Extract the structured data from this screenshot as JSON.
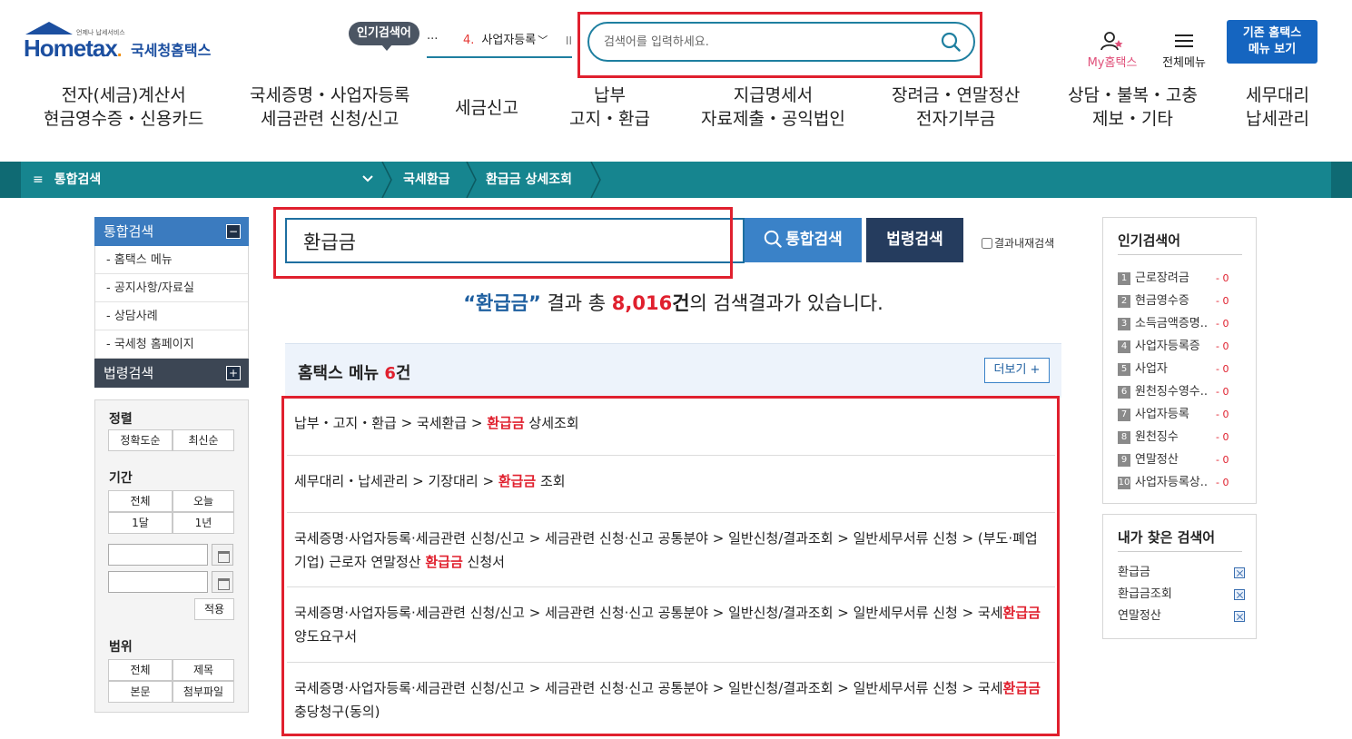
{
  "header": {
    "logo_tagline": "언제나 납세서비스",
    "logo_main": "Hometax",
    "logo_suffix": ".",
    "logo_korean": "국세청홈택스",
    "popular_badge": "인기검색어",
    "popular_dots": "···",
    "popular_ticker_rank": "4.",
    "popular_ticker_keyword": "사업자등록",
    "popular_ticker_pause": "II",
    "search_placeholder": "검색어를 입력하세요.",
    "my_hometax": "My홈택스",
    "all_menu": "전체메뉴",
    "old_menu_line1": "기존 홈택스",
    "old_menu_line2": "메뉴 보기"
  },
  "gnb": [
    {
      "line1": "전자(세금)계산서",
      "line2": "현금영수증・신용카드"
    },
    {
      "line1": "국세증명・사업자등록",
      "line2": "세금관련 신청/신고"
    },
    {
      "line1": "세금신고",
      "line2": ""
    },
    {
      "line1": "납부",
      "line2": "고지・환급"
    },
    {
      "line1": "지급명세서",
      "line2": "자료제출・공익법인"
    },
    {
      "line1": "장려금・연말정산",
      "line2": "전자기부금"
    },
    {
      "line1": "상담・불복・고충",
      "line2": "제보・기타"
    },
    {
      "line1": "세무대리",
      "line2": "납세관리"
    }
  ],
  "location": {
    "menu_icon": "≡",
    "menu_label": "통합검색",
    "crumb1": "국세환급",
    "crumb2": "환급금 상세조회"
  },
  "sidebar": {
    "total_search": "통합검색",
    "total_toggle": "−",
    "items": [
      "- 홈택스 메뉴",
      "- 공지사항/자료실",
      "- 상담사례",
      "- 국세청 홈페이지"
    ],
    "law_search": "법령검색",
    "law_toggle": "+",
    "sort_label": "정렬",
    "sort_options": [
      "정확도순",
      "최신순"
    ],
    "period_label": "기간",
    "period_options": [
      "전체",
      "오늘",
      "1달",
      "1년"
    ],
    "apply_label": "적용",
    "scope_label": "범위",
    "scope_options": [
      "전체",
      "제목",
      "본문",
      "첨부파일"
    ]
  },
  "search": {
    "query": "환급금",
    "total_button": "통합검색",
    "law_button": "법령검색",
    "within_results": "결과내재검색"
  },
  "summary": {
    "query_quoted": "“환급금”",
    "text_before": " 결과 총 ",
    "count": "8,016",
    "unit": "건",
    "text_after": "의 검색결과가 있습니다."
  },
  "section": {
    "title": "홈택스 메뉴 ",
    "count": "6",
    "unit": "건",
    "more": "더보기 +"
  },
  "results": [
    {
      "before": "납부・고지・환급 > 국세환급 > ",
      "highlight": "환급금",
      "after": " 상세조회"
    },
    {
      "before": "세무대리・납세관리 > 기장대리 > ",
      "highlight": "환급금",
      "after": " 조회"
    },
    {
      "before": "국세증명·사업자등록·세금관련 신청/신고 > 세금관련 신청·신고 공통분야 > 일반신청/결과조회 > 일반세무서류 신청 > (부도·폐업기업) 근로자 연말정산 ",
      "highlight": "환급금",
      "after": " 신청서"
    },
    {
      "before": "국세증명·사업자등록·세금관련 신청/신고 > 세금관련 신청·신고 공통분야 > 일반신청/결과조회 > 일반세무서류 신청 > 국세",
      "highlight": "환급금",
      "after": " 양도요구서"
    },
    {
      "before": "국세증명·사업자등록·세금관련 신청/신고 > 세금관련 신청·신고 공통분야 > 일반신청/결과조회 > 일반세무서류 신청 > 국세",
      "highlight": "환급금",
      "after": "충당청구(동의)"
    }
  ],
  "popular": {
    "title": "인기검색어",
    "items": [
      {
        "rank": "1",
        "keyword": "근로장려금",
        "delta": "- 0"
      },
      {
        "rank": "2",
        "keyword": "현금영수증",
        "delta": "- 0"
      },
      {
        "rank": "3",
        "keyword": "소득금액증명..",
        "delta": "- 0"
      },
      {
        "rank": "4",
        "keyword": "사업자등록증",
        "delta": "- 0"
      },
      {
        "rank": "5",
        "keyword": "사업자",
        "delta": "- 0"
      },
      {
        "rank": "6",
        "keyword": "원천징수영수..",
        "delta": "- 0"
      },
      {
        "rank": "7",
        "keyword": "사업자등록",
        "delta": "- 0"
      },
      {
        "rank": "8",
        "keyword": "원천징수",
        "delta": "- 0"
      },
      {
        "rank": "9",
        "keyword": "연말정산",
        "delta": "- 0"
      },
      {
        "rank": "10",
        "keyword": "사업자등록상..",
        "delta": "- 0"
      }
    ]
  },
  "my_searches": {
    "title": "내가 찾은 검색어",
    "items": [
      "환급금",
      "환급금조회",
      "연말정산"
    ]
  }
}
